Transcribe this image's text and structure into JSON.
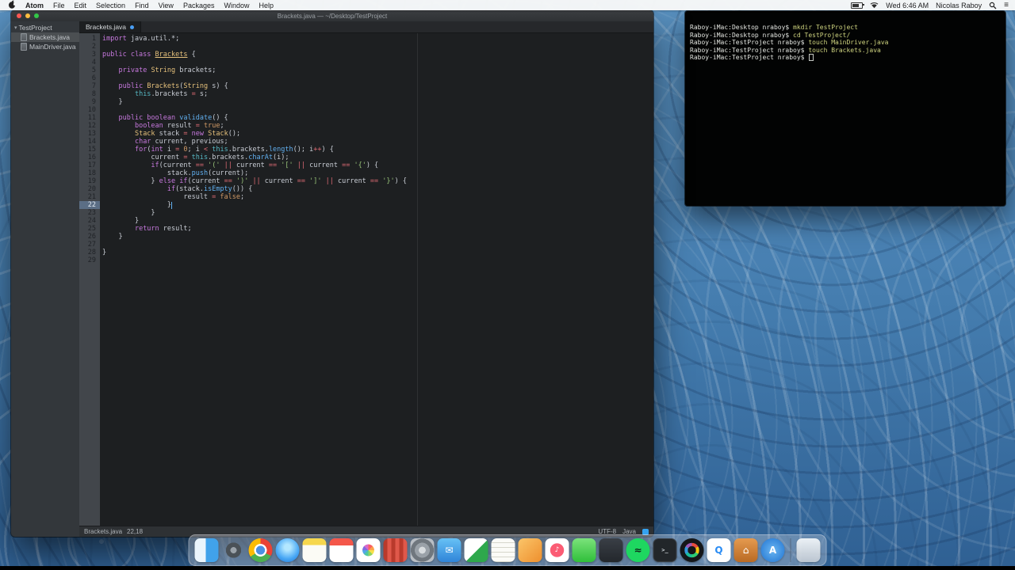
{
  "colors": {
    "accent_blue": "#4a9ff5",
    "editor_bg": "#1d1f21",
    "terminal_bg": "#020303",
    "wallpaper_blue": "#4d86b5"
  },
  "menu_bar": {
    "items": [
      "Atom",
      "File",
      "Edit",
      "Selection",
      "Find",
      "View",
      "Packages",
      "Window",
      "Help"
    ],
    "status": {
      "time": "Wed 6:46 AM",
      "user": "Nicolas Raboy"
    }
  },
  "atom": {
    "title": "Brackets.java — ~/Desktop/TestProject",
    "tree": {
      "root": "TestProject",
      "files": [
        "Brackets.java",
        "MainDriver.java"
      ],
      "selected": "Brackets.java"
    },
    "tab": {
      "label": "Brackets.java",
      "modified": true
    },
    "status_bar": {
      "file": "Brackets.java",
      "position": "22,18",
      "encoding": "UTF-8",
      "language": "Java"
    },
    "code": {
      "cursor_line": 22,
      "lines": [
        {
          "n": 1,
          "t": [
            [
              "k",
              "import"
            ],
            [
              "v",
              " java.util.*;"
            ]
          ]
        },
        {
          "n": 2,
          "t": []
        },
        {
          "n": 3,
          "t": [
            [
              "k",
              "public class "
            ],
            [
              "tu",
              "Brackets"
            ],
            [
              "v",
              " {"
            ]
          ]
        },
        {
          "n": 4,
          "t": []
        },
        {
          "n": 5,
          "t": [
            [
              "v",
              "    "
            ],
            [
              "k",
              "private "
            ],
            [
              "t",
              "String"
            ],
            [
              "v",
              " brackets;"
            ]
          ]
        },
        {
          "n": 6,
          "t": []
        },
        {
          "n": 7,
          "t": [
            [
              "v",
              "    "
            ],
            [
              "k",
              "public "
            ],
            [
              "t",
              "Brackets"
            ],
            [
              "v",
              "("
            ],
            [
              "t",
              "String"
            ],
            [
              "v",
              " s) {"
            ]
          ]
        },
        {
          "n": 8,
          "t": [
            [
              "v",
              "        "
            ],
            [
              "th",
              "this"
            ],
            [
              "v",
              ".brackets "
            ],
            [
              "o",
              "="
            ],
            [
              "v",
              " s;"
            ]
          ]
        },
        {
          "n": 9,
          "t": [
            [
              "v",
              "    }"
            ]
          ]
        },
        {
          "n": 10,
          "t": []
        },
        {
          "n": 11,
          "t": [
            [
              "v",
              "    "
            ],
            [
              "k",
              "public boolean "
            ],
            [
              "f",
              "validate"
            ],
            [
              "v",
              "() {"
            ]
          ]
        },
        {
          "n": 12,
          "t": [
            [
              "v",
              "        "
            ],
            [
              "k",
              "boolean"
            ],
            [
              "v",
              " result "
            ],
            [
              "o",
              "="
            ],
            [
              "v",
              " "
            ],
            [
              "n",
              "true"
            ],
            [
              "v",
              ";"
            ]
          ]
        },
        {
          "n": 13,
          "t": [
            [
              "v",
              "        "
            ],
            [
              "t",
              "Stack"
            ],
            [
              "v",
              " stack "
            ],
            [
              "o",
              "="
            ],
            [
              "v",
              " "
            ],
            [
              "k",
              "new "
            ],
            [
              "t",
              "Stack"
            ],
            [
              "v",
              "();"
            ]
          ]
        },
        {
          "n": 14,
          "t": [
            [
              "v",
              "        "
            ],
            [
              "k",
              "char"
            ],
            [
              "v",
              " current, previous;"
            ]
          ]
        },
        {
          "n": 15,
          "t": [
            [
              "v",
              "        "
            ],
            [
              "k",
              "for"
            ],
            [
              "v",
              "("
            ],
            [
              "k",
              "int"
            ],
            [
              "v",
              " i "
            ],
            [
              "o",
              "="
            ],
            [
              "v",
              " "
            ],
            [
              "n",
              "0"
            ],
            [
              "v",
              "; i "
            ],
            [
              "o",
              "<"
            ],
            [
              "v",
              " "
            ],
            [
              "th",
              "this"
            ],
            [
              "v",
              ".brackets."
            ],
            [
              "f",
              "length"
            ],
            [
              "v",
              "(); i"
            ],
            [
              "o",
              "++"
            ],
            [
              "v",
              ") {"
            ]
          ]
        },
        {
          "n": 16,
          "t": [
            [
              "v",
              "            current "
            ],
            [
              "o",
              "="
            ],
            [
              "v",
              " "
            ],
            [
              "th",
              "this"
            ],
            [
              "v",
              ".brackets."
            ],
            [
              "f",
              "charAt"
            ],
            [
              "v",
              "(i);"
            ]
          ]
        },
        {
          "n": 17,
          "t": [
            [
              "v",
              "            "
            ],
            [
              "k",
              "if"
            ],
            [
              "v",
              "(current "
            ],
            [
              "o",
              "=="
            ],
            [
              "v",
              " "
            ],
            [
              "s",
              "'('"
            ],
            [
              "v",
              " "
            ],
            [
              "o",
              "||"
            ],
            [
              "v",
              " current "
            ],
            [
              "o",
              "=="
            ],
            [
              "v",
              " "
            ],
            [
              "s",
              "'['"
            ],
            [
              "v",
              " "
            ],
            [
              "o",
              "||"
            ],
            [
              "v",
              " current "
            ],
            [
              "o",
              "=="
            ],
            [
              "v",
              " "
            ],
            [
              "s",
              "'{'"
            ],
            [
              "v",
              ") {"
            ]
          ]
        },
        {
          "n": 18,
          "t": [
            [
              "v",
              "                stack."
            ],
            [
              "f",
              "push"
            ],
            [
              "v",
              "(current);"
            ]
          ]
        },
        {
          "n": 19,
          "t": [
            [
              "v",
              "            } "
            ],
            [
              "k",
              "else"
            ],
            [
              "v",
              " "
            ],
            [
              "k",
              "if"
            ],
            [
              "v",
              "(current "
            ],
            [
              "o",
              "=="
            ],
            [
              "v",
              " "
            ],
            [
              "s",
              "')'"
            ],
            [
              "v",
              " "
            ],
            [
              "o",
              "||"
            ],
            [
              "v",
              " current "
            ],
            [
              "o",
              "=="
            ],
            [
              "v",
              " "
            ],
            [
              "s",
              "']'"
            ],
            [
              "v",
              " "
            ],
            [
              "o",
              "||"
            ],
            [
              "v",
              " current "
            ],
            [
              "o",
              "=="
            ],
            [
              "v",
              " "
            ],
            [
              "s",
              "'}'"
            ],
            [
              "v",
              ") {"
            ]
          ]
        },
        {
          "n": 20,
          "t": [
            [
              "v",
              "                "
            ],
            [
              "k",
              "if"
            ],
            [
              "v",
              "(stack."
            ],
            [
              "f",
              "isEmpty"
            ],
            [
              "v",
              "()) {"
            ]
          ]
        },
        {
          "n": 21,
          "t": [
            [
              "v",
              "                    result "
            ],
            [
              "o",
              "="
            ],
            [
              "v",
              " "
            ],
            [
              "n",
              "false"
            ],
            [
              "v",
              ";"
            ]
          ]
        },
        {
          "n": 22,
          "t": [
            [
              "v",
              "                }"
            ]
          ]
        },
        {
          "n": 23,
          "t": [
            [
              "v",
              "            }"
            ]
          ]
        },
        {
          "n": 24,
          "t": [
            [
              "v",
              "        }"
            ]
          ]
        },
        {
          "n": 25,
          "t": [
            [
              "v",
              "        "
            ],
            [
              "k",
              "return"
            ],
            [
              "v",
              " result;"
            ]
          ]
        },
        {
          "n": 26,
          "t": [
            [
              "v",
              "    }"
            ]
          ]
        },
        {
          "n": 27,
          "t": []
        },
        {
          "n": 28,
          "t": [
            [
              "v",
              "}"
            ]
          ]
        },
        {
          "n": 29,
          "t": []
        }
      ]
    }
  },
  "terminal": {
    "cursor": true,
    "lines": [
      [
        [
          "p",
          "Raboy-iMac:Desktop nraboy$ "
        ],
        [
          "c",
          "mkdir TestProject"
        ]
      ],
      [
        [
          "p",
          "Raboy-iMac:Desktop nraboy$ "
        ],
        [
          "c",
          "cd TestProject/"
        ]
      ],
      [
        [
          "p",
          "Raboy-iMac:TestProject nraboy$ "
        ],
        [
          "c",
          "touch MainDriver.java"
        ]
      ],
      [
        [
          "p",
          "Raboy-iMac:TestProject nraboy$ "
        ],
        [
          "c",
          "touch Brackets.java"
        ]
      ],
      [
        [
          "p",
          "Raboy-iMac:TestProject nraboy$ "
        ]
      ]
    ]
  },
  "dock": {
    "items": [
      {
        "name": "finder",
        "glyph": ""
      },
      {
        "name": "launchpad",
        "glyph": ""
      },
      {
        "name": "chrome",
        "glyph": ""
      },
      {
        "name": "safari",
        "glyph": ""
      },
      {
        "name": "notes",
        "glyph": ""
      },
      {
        "name": "calendar",
        "glyph": ""
      },
      {
        "name": "photos",
        "glyph": ""
      },
      {
        "name": "photo-booth",
        "glyph": ""
      },
      {
        "name": "system-preferences",
        "glyph": ""
      },
      {
        "name": "mail",
        "glyph": "✉"
      },
      {
        "name": "stocks",
        "glyph": ""
      },
      {
        "name": "textedit",
        "glyph": ""
      },
      {
        "name": "pages",
        "glyph": ""
      },
      {
        "name": "itunes",
        "glyph": "♪"
      },
      {
        "name": "facetime",
        "glyph": ""
      },
      {
        "name": "dark-app",
        "glyph": ""
      },
      {
        "name": "spotify",
        "glyph": "≈"
      },
      {
        "name": "terminal",
        "glyph": ">_"
      },
      {
        "name": "aperture",
        "glyph": ""
      },
      {
        "name": "quicktime",
        "glyph": "Q"
      },
      {
        "name": "home-app",
        "glyph": "⌂"
      },
      {
        "name": "app-store",
        "glyph": "A"
      },
      {
        "name": "divider",
        "glyph": ""
      },
      {
        "name": "trash",
        "glyph": ""
      }
    ]
  }
}
